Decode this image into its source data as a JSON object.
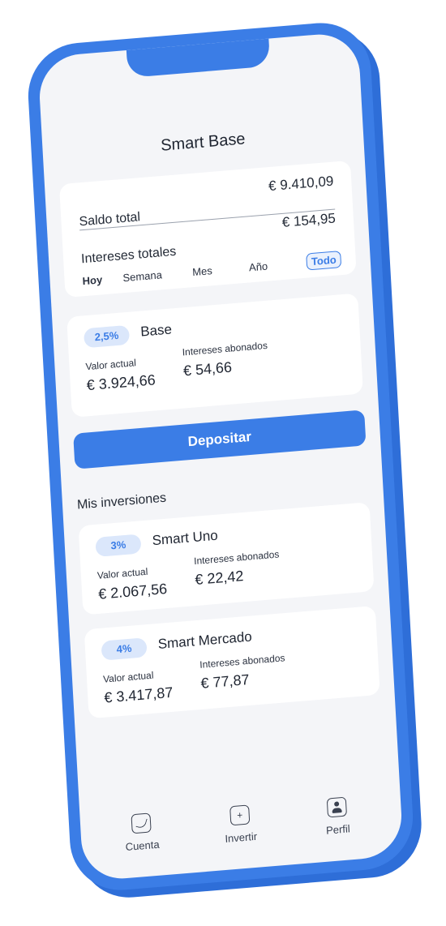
{
  "screen": {
    "title": "Smart Base"
  },
  "summary": {
    "saldo_label": "Saldo total",
    "saldo_value": "€ 9.410,09",
    "intereses_label": "Intereses totales",
    "intereses_value": "€ 154,95",
    "periods": [
      "Hoy",
      "Semana",
      "Mes",
      "Año",
      "Todo"
    ],
    "active_period": "Todo"
  },
  "base": {
    "rate": "2,5%",
    "name": "Base",
    "current_label": "Valor actual",
    "current_value": "€ 3.924,66",
    "interest_label": "Intereses abonados",
    "interest_value": "€ 54,66"
  },
  "deposit_label": "Depositar",
  "investments": {
    "section_title": "Mis inversiones",
    "items": [
      {
        "rate": "3%",
        "name": "Smart Uno",
        "current_label": "Valor actual",
        "current_value": "€ 2.067,56",
        "interest_label": "Intereses abonados",
        "interest_value": "€ 22,42"
      },
      {
        "rate": "4%",
        "name": "Smart Mercado",
        "current_label": "Valor actual",
        "current_value": "€ 3.417,87",
        "interest_label": "Intereses abonados",
        "interest_value": "€ 77,87"
      }
    ]
  },
  "tabbar": {
    "items": [
      {
        "label": "Cuenta",
        "icon": "clock-icon"
      },
      {
        "label": "Invertir",
        "icon": "plus-icon"
      },
      {
        "label": "Perfil",
        "icon": "person-icon"
      }
    ]
  },
  "colors": {
    "accent": "#3b7de6",
    "background": "#f4f5f8",
    "badge_bg": "#dbe7fb"
  }
}
